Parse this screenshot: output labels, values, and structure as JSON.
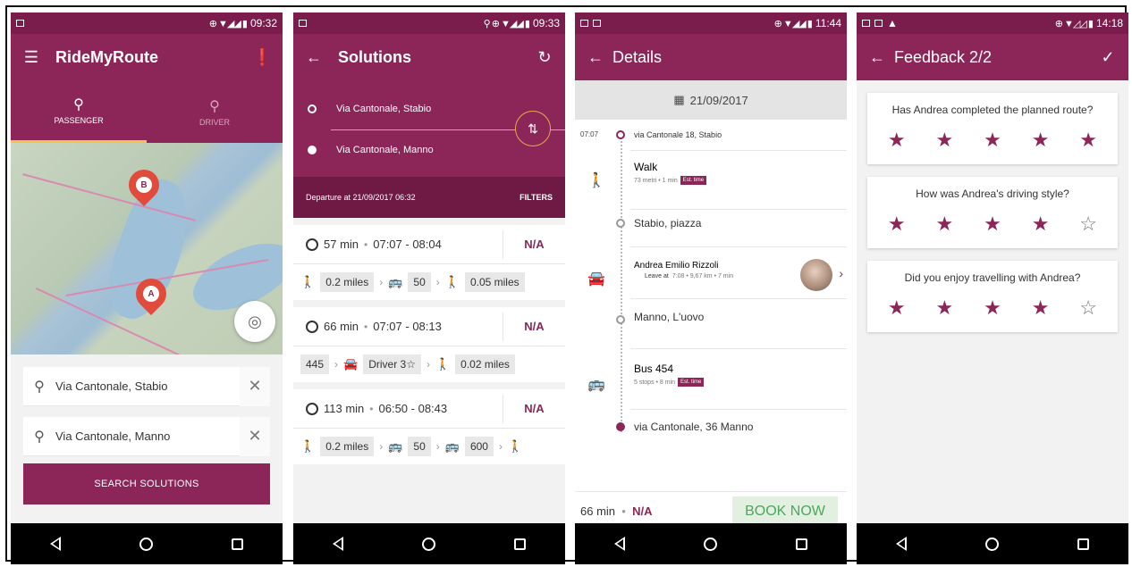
{
  "phone1": {
    "status_time": "09:32",
    "app_title": "RideMyRoute",
    "tabs": [
      {
        "label": "PASSENGER"
      },
      {
        "label": "DRIVER"
      }
    ],
    "map_pins": [
      "B",
      "A"
    ],
    "from_address": "Via Cantonale, Stabio",
    "to_address": "Via Cantonale, Manno",
    "search_button": "SEARCH SOLUTIONS"
  },
  "phone2": {
    "status_time": "09:33",
    "title": "Solutions",
    "from": "Via Cantonale, Stabio",
    "to": "Via Cantonale, Manno",
    "departure": "Departure at 21/09/2017 06:32",
    "filters": "FILTERS",
    "solutions": [
      {
        "duration": "57 min",
        "times": "07:07 - 08:04",
        "price": "N/A",
        "steps": [
          "0.2 miles",
          "50",
          "0.05 miles"
        ]
      },
      {
        "duration": "66 min",
        "times": "07:07 - 08:13",
        "price": "N/A",
        "steps": [
          "445",
          "Driver 3☆",
          "0.02 miles"
        ]
      },
      {
        "duration": "113 min",
        "times": "06:50 - 08:43",
        "price": "N/A",
        "steps": [
          "0.2 miles",
          "50",
          "600"
        ]
      }
    ]
  },
  "phone3": {
    "status_time": "11:44",
    "title": "Details",
    "date": "21/09/2017",
    "start_time": "07:07",
    "start_place": "via Cantonale 18, Stabio",
    "walk_title": "Walk",
    "walk_meta": "73 metri",
    "walk_dur": "1 min",
    "est_time": "Est. time",
    "stop1": "Stabio, piazza",
    "driver_name": "Andrea Emilio Rizzoli",
    "driver_leave_label": "Leave at",
    "driver_leave_time": "7:08",
    "driver_km": "9,67 km",
    "driver_min": "7 min",
    "stop2": "Manno, L'uovo",
    "bus_title": "Bus 454",
    "bus_stops": "5 stops",
    "bus_min": "8 min",
    "end_place": "via Cantonale, 36 Manno",
    "total_min": "66 min",
    "total_price": "N/A",
    "book_button": "BOOK NOW"
  },
  "phone4": {
    "status_time": "14:18",
    "title": "Feedback 2/2",
    "questions": [
      {
        "text": "Has Andrea completed the planned route?",
        "rating": 5
      },
      {
        "text": "How was Andrea's driving style?",
        "rating": 4
      },
      {
        "text": "Did you enjoy travelling with Andrea?",
        "rating": 4
      }
    ],
    "max_stars": 5
  },
  "colors": {
    "primary": "#8c2658",
    "primary_dark": "#7a1d4c",
    "accent": "#e8a84a",
    "book": "#4aa85a"
  }
}
